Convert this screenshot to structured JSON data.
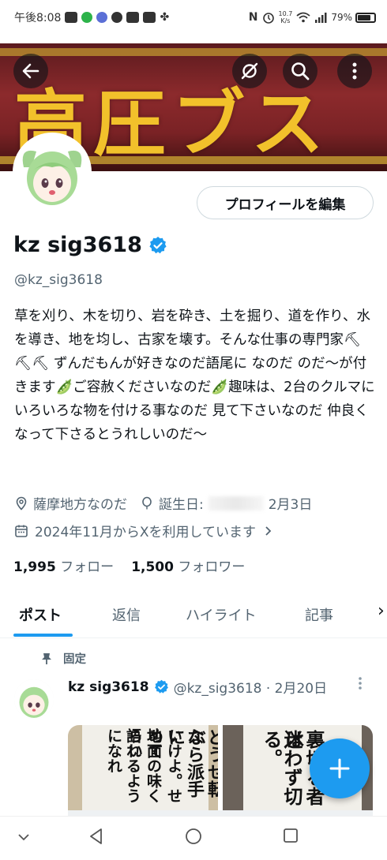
{
  "status_bar": {
    "time": "午後8:08",
    "net_speed_top": "10.7",
    "net_speed_unit": "K/s",
    "battery": "79%"
  },
  "profile": {
    "name": "kz sig3618",
    "handle": "@kz_sig3618",
    "edit_button": "プロフィールを編集",
    "banner_text": "高圧ブス",
    "bio": "草を刈り、木を切り、岩を砕き、土を掘り、道を作り、水を導き、地を均し、古家を壊す。そんな仕事の専門家⛏⛏⛏ ずんだもんが好きなのだ語尾に なのだ のだ〜が付きます🫛ご容赦くださいなのだ🫛趣味は、2台のクルマにいろいろな物を付ける事なのだ 見て下さいなのだ 仲良くなって下さるとうれしいのだ〜",
    "location": "薩摩地方なのだ",
    "birthday_label": "誕生日:",
    "birthday_value": "2月3日",
    "joined": "2024年11月からXを利用しています",
    "following_count": "1,995",
    "following_label": "フォロー",
    "followers_count": "1,500",
    "followers_label": "フォロワー"
  },
  "tabs": [
    "ポスト",
    "返信",
    "ハイライト",
    "記事"
  ],
  "tabs_more": "›",
  "pinned_post": {
    "pinned_label": "固定",
    "name": "kz sig3618",
    "handle_date": "@kz_sig3618 · 2月20日",
    "image1_text": [
      "どうせ転ぶ",
      "なら派手に",
      "いけよ。せめて",
      "地面の味くらい",
      "語れるようになれ"
    ],
    "image2_text": [
      "裏切る者は",
      "迷わず切る。"
    ]
  },
  "colors": {
    "accent": "#1d9bf0",
    "text": "#0f1419",
    "secondary": "#536471",
    "banner_text": "#f2c12b"
  },
  "icons": [
    "back-arrow-icon",
    "hide-icon",
    "search-icon",
    "more-vert-icon",
    "verified-badge-icon",
    "location-icon",
    "balloon-icon",
    "calendar-icon",
    "pin-icon",
    "compose-plus-icon",
    "nav-back-icon",
    "nav-home-icon",
    "nav-recents-icon",
    "nav-down-icon"
  ]
}
